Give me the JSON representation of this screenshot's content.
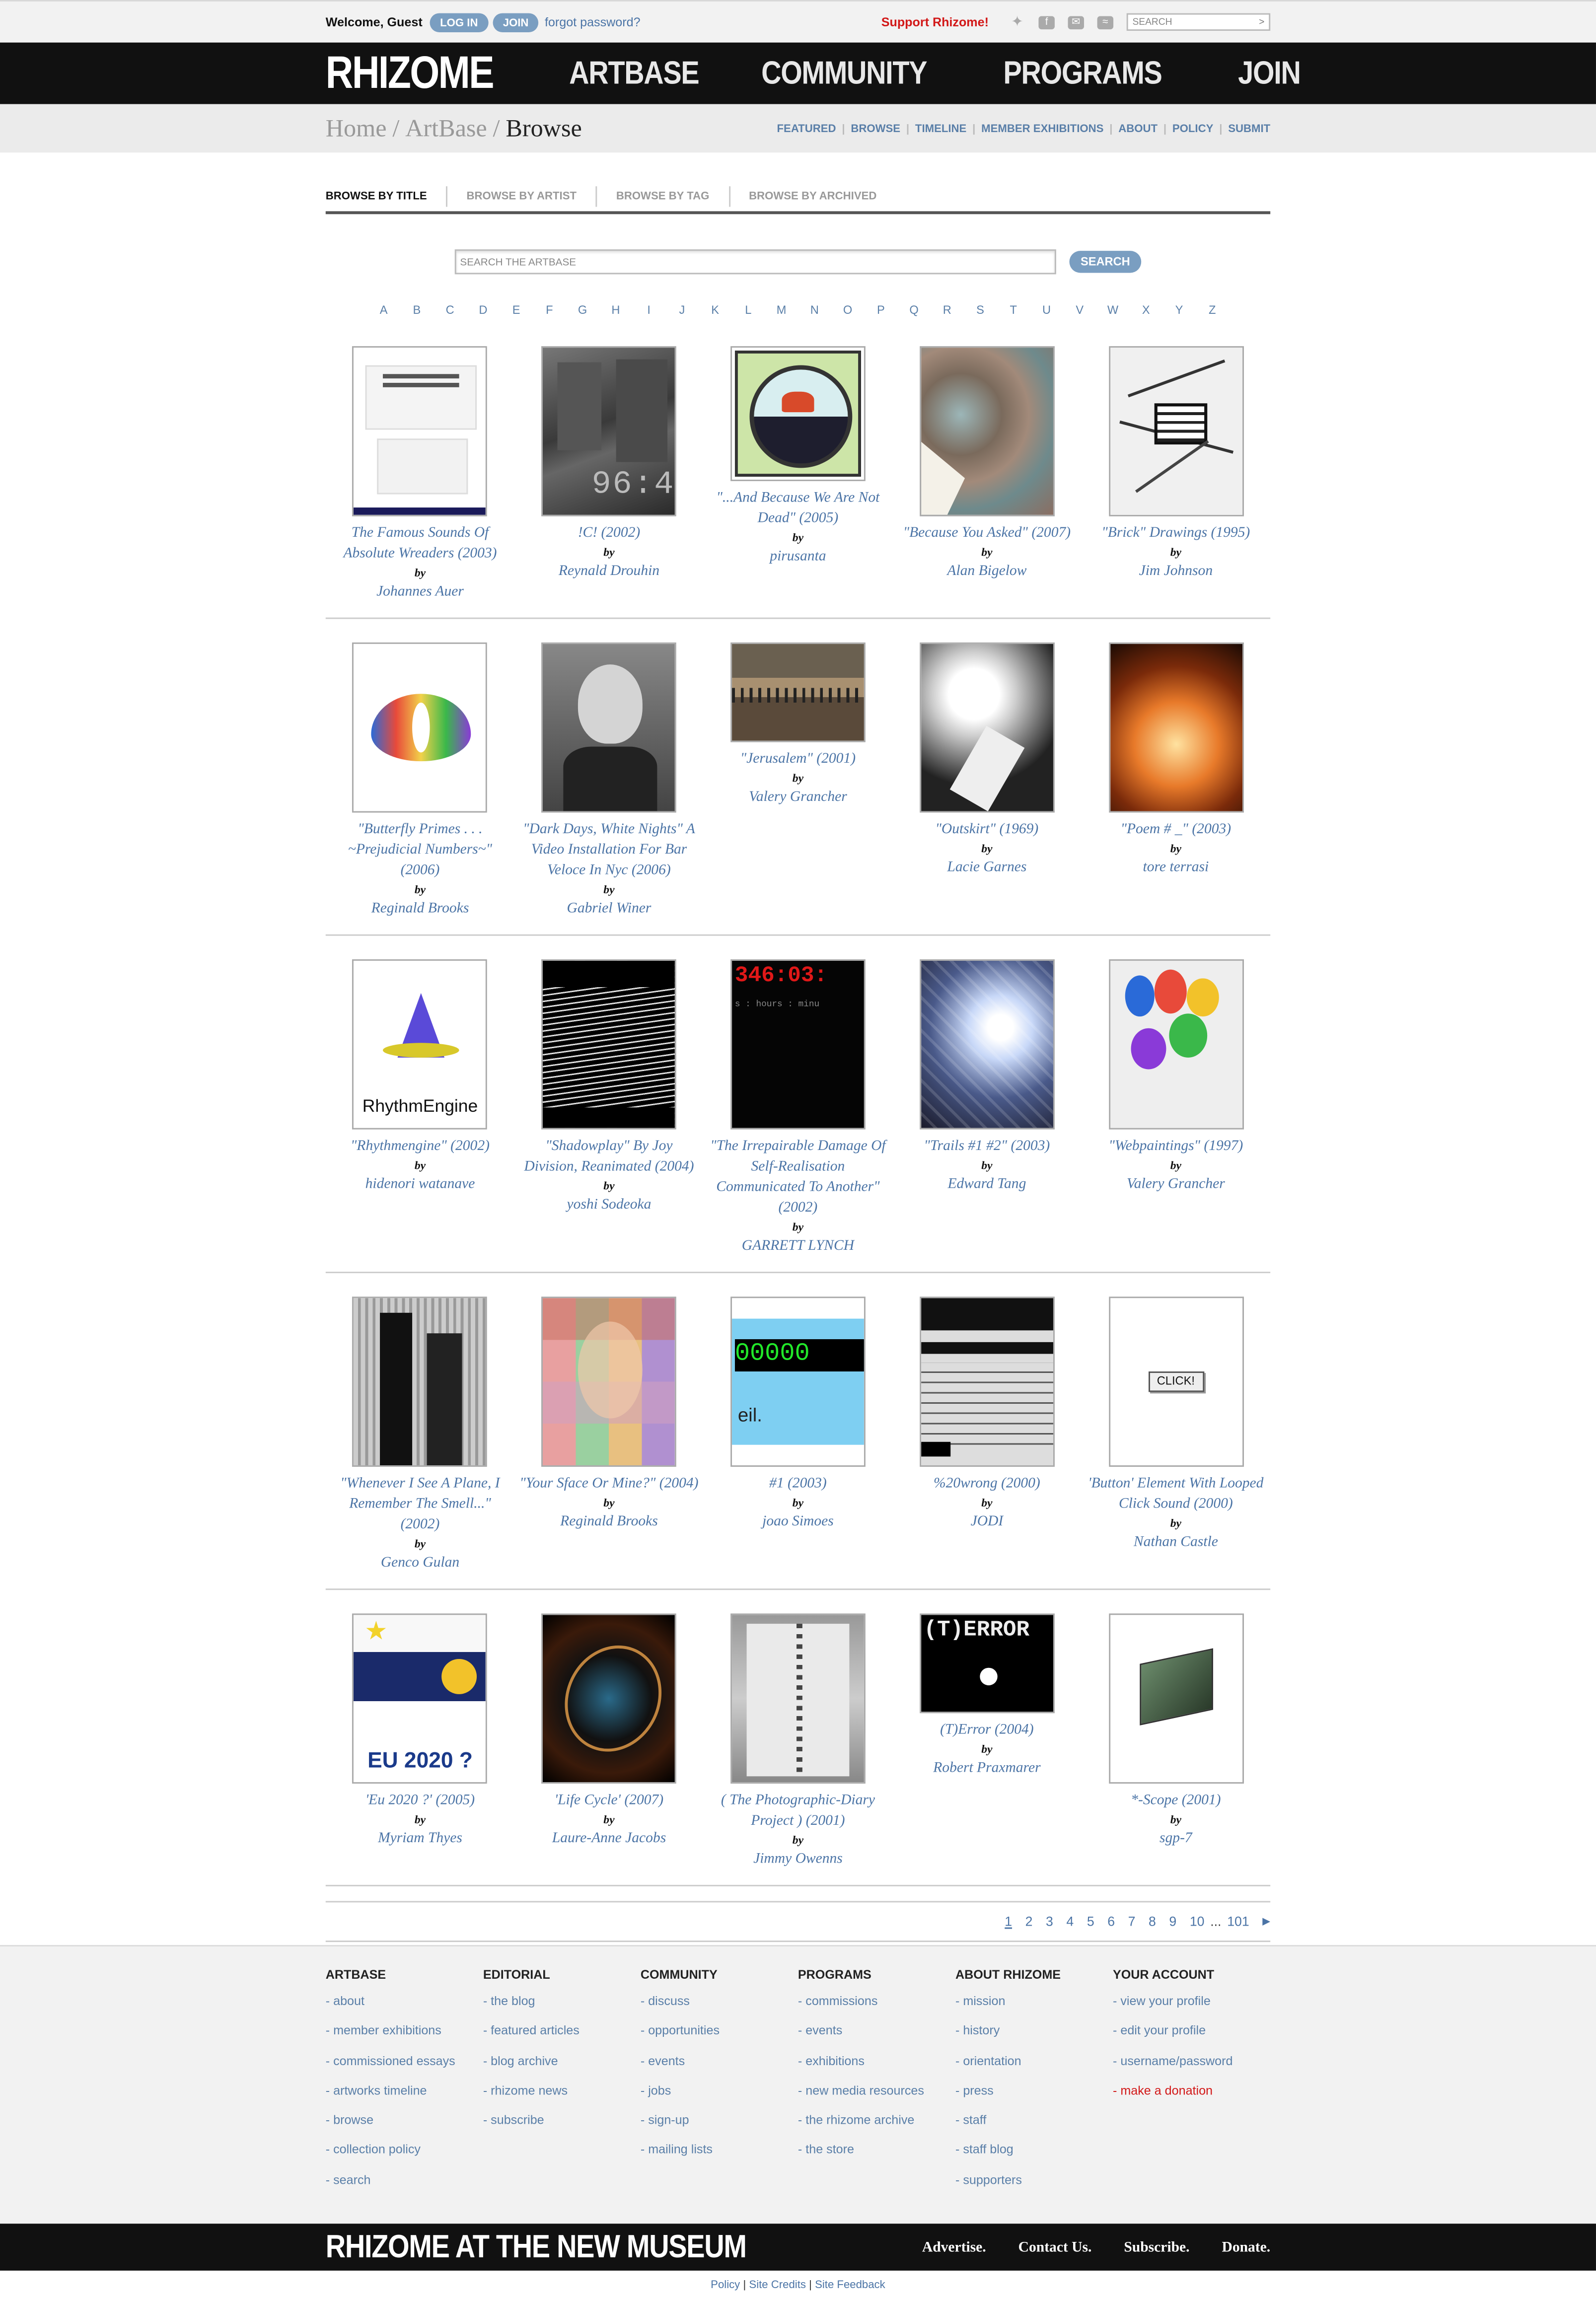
{
  "topbar": {
    "welcome": "Welcome, Guest",
    "login": "LOG IN",
    "join": "JOIN",
    "forgot": "forgot password?",
    "support": "Support Rhizome!",
    "search_placeholder": "SEARCH",
    "search_go": ">"
  },
  "header": {
    "logo": "RHIZOME",
    "nav": [
      "ARTBASE",
      "COMMUNITY",
      "PROGRAMS",
      "JOIN"
    ]
  },
  "breadcrumb": {
    "home": "Home",
    "artbase": "ArtBase",
    "current": "Browse",
    "sep": "/"
  },
  "subnav": [
    "FEATURED",
    "BROWSE",
    "TIMELINE",
    "MEMBER EXHIBITIONS",
    "ABOUT",
    "POLICY",
    "SUBMIT"
  ],
  "tabs": [
    "BROWSE BY TITLE",
    "BROWSE BY ARTIST",
    "BROWSE BY TAG",
    "BROWSE BY ARCHIVED"
  ],
  "search": {
    "placeholder": "SEARCH THE ARTBASE",
    "button": "SEARCH"
  },
  "alphabet": [
    "A",
    "B",
    "C",
    "D",
    "E",
    "F",
    "G",
    "H",
    "I",
    "J",
    "K",
    "L",
    "M",
    "N",
    "O",
    "P",
    "Q",
    "R",
    "S",
    "T",
    "U",
    "V",
    "W",
    "X",
    "Y",
    "Z"
  ],
  "by_label": "by",
  "artworks": [
    [
      {
        "title": "The Famous Sounds Of Absolute Wreaders (2003)",
        "author": "Johannes Auer",
        "thumb": "book-cover"
      },
      {
        "title": "!C! (2002)",
        "author": "Reynald Drouhin",
        "thumb": "street-photo"
      },
      {
        "title": "\"...And Because We Are Not Dead\" (2005)",
        "author": "pirusanta",
        "thumb": "butterfly-circle"
      },
      {
        "title": "\"Because You Asked\" (2007)",
        "author": "Alan Bigelow",
        "thumb": "map-texture"
      },
      {
        "title": "\"Brick\" Drawings (1995)",
        "author": "Jim Johnson",
        "thumb": "brick-sketch"
      }
    ],
    [
      {
        "title": "\"Butterfly Primes . . . ~Prejudicial Numbers~\" (2006)",
        "author": "Reginald Brooks",
        "thumb": "butterfly-shape"
      },
      {
        "title": "\"Dark Days, White Nights\" A Video Installation For Bar Veloce In Nyc (2006)",
        "author": "Gabriel Winer",
        "thumb": "portrait-bw"
      },
      {
        "title": "\"Jerusalem\" (2001)",
        "author": "Valery Grancher",
        "thumb": "crowd-photo"
      },
      {
        "title": "\"Outskirt\" (1969)",
        "author": "Lacie Garnes",
        "thumb": "bright-light"
      },
      {
        "title": "\"Poem # _\" (2003)",
        "author": "tore terrasi",
        "thumb": "fire"
      }
    ],
    [
      {
        "title": "\"Rhythmengine\" (2002)",
        "author": "hidenori watanave",
        "thumb": "cone-logo",
        "caption": "RhythmEngine"
      },
      {
        "title": "\"Shadowplay\" By Joy Division, Reanimated (2004)",
        "author": "yoshi Sodeoka",
        "thumb": "wave-lines"
      },
      {
        "title": "\"The Irrepairable Damage Of Self-Realisation Communicated To Another\" (2002)",
        "author": "GARRETT LYNCH",
        "thumb": "red-clock",
        "caption": "346:03:",
        "caption2": "s : hours : minu"
      },
      {
        "title": "\"Trails #1 #2\" (2003)",
        "author": "Edward Tang",
        "thumb": "light-trails"
      },
      {
        "title": "\"Webpaintings\" (1997)",
        "author": "Valery Grancher",
        "thumb": "google-paint"
      }
    ],
    [
      {
        "title": "\"Whenever I See A Plane, I Remember The Smell...\" (2002)",
        "author": "Genco Gulan",
        "thumb": "towers"
      },
      {
        "title": "\"Your Sface Or Mine?\" (2004)",
        "author": "Reginald Brooks",
        "thumb": "mosaic-face"
      },
      {
        "title": "#1 (2003)",
        "author": "joao Simoes",
        "thumb": "lcd-counter",
        "caption": "00000",
        "caption2": "eil."
      },
      {
        "title": "%20wrong (2000)",
        "author": "JODI",
        "thumb": "code-screen"
      },
      {
        "title": "'Button' Element With Looped Click Sound (2000)",
        "author": "Nathan Castle",
        "thumb": "click-button",
        "caption": "CLICK!"
      }
    ],
    [
      {
        "title": "'Eu 2020 ?' (2005)",
        "author": "Myriam Thyes",
        "thumb": "eu-flag",
        "caption": "EU 2020 ?"
      },
      {
        "title": "'Life Cycle' (2007)",
        "author": "Laure-Anne Jacobs",
        "thumb": "swirl"
      },
      {
        "title": "( The Photographic-Diary Project ) (2001)",
        "author": "Jimmy Owenns",
        "thumb": "notebook"
      },
      {
        "title": "(T)Error (2004)",
        "author": "Robert Praxmarer",
        "thumb": "terror-screen",
        "caption": "(T)ERROR"
      },
      {
        "title": "*-Scope (2001)",
        "author": "sgp-7",
        "thumb": "green-box"
      }
    ]
  ],
  "pagination": [
    "1",
    "2",
    "3",
    "4",
    "5",
    "6",
    "7",
    "8",
    "9",
    "10",
    "...",
    "101"
  ],
  "pagination_next": "▶",
  "footer": {
    "columns": [
      {
        "heading": "ARTBASE",
        "links": [
          "- about",
          "- member exhibitions",
          "- commissioned essays",
          "- artworks timeline",
          "- browse",
          "- collection policy",
          "- search"
        ]
      },
      {
        "heading": "EDITORIAL",
        "links": [
          "- the blog",
          "- featured articles",
          "- blog archive",
          "- rhizome news",
          "- subscribe"
        ]
      },
      {
        "heading": "COMMUNITY",
        "links": [
          "- discuss",
          "- opportunities",
          "- events",
          "- jobs",
          "- sign-up",
          "- mailing lists"
        ]
      },
      {
        "heading": "PROGRAMS",
        "links": [
          "- commissions",
          "- events",
          "- exhibitions",
          "- new media resources",
          "- the rhizome archive",
          "- the store"
        ]
      },
      {
        "heading": "ABOUT RHIZOME",
        "links": [
          "- mission",
          "- history",
          "- orientation",
          "- press",
          "- staff",
          "- staff blog",
          "- supporters"
        ]
      },
      {
        "heading": "YOUR ACCOUNT",
        "links": [
          "- view your profile",
          "- edit your profile",
          "- username/password",
          "- make a donation"
        ]
      }
    ],
    "bottom_logo": "RHIZOME AT THE NEW MUSEUM",
    "bottom_links": [
      "Advertise.",
      "Contact Us.",
      "Subscribe.",
      "Donate."
    ],
    "legal": [
      "Policy",
      "Site Credits",
      "Site Feedback"
    ],
    "legal_sep": "|"
  },
  "colors": {
    "accent": "#4b74a6",
    "pill": "#7a9ec1",
    "support": "#d21818",
    "header_bg": "#111111"
  }
}
